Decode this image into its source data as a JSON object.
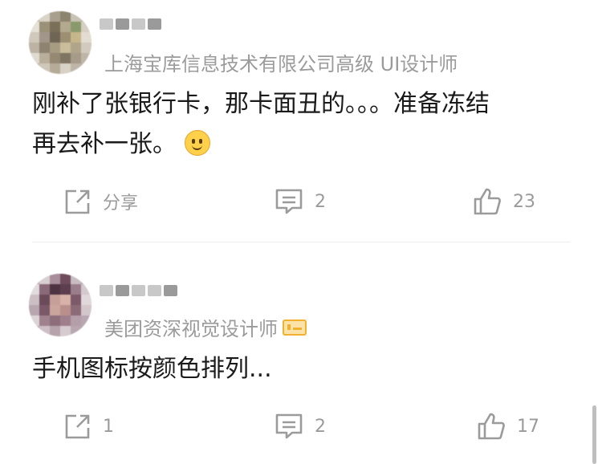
{
  "comments": [
    {
      "author_subtitle": "上海宝库信息技术有限公司高级 UI设计师",
      "verified_badge": false,
      "text_line1": "刚补了张银行卡，那卡面丑的。。。准备冻结",
      "text_line2": "再去补一张。",
      "emoji": "slightly-smiling-face",
      "share_label": "分享",
      "comment_count": "2",
      "like_count": "23"
    },
    {
      "author_subtitle": "美团资深视觉设计师",
      "verified_badge": true,
      "text_line1": "手机图标按颜色排列...",
      "share_label": "1",
      "comment_count": "2",
      "like_count": "17"
    }
  ],
  "icons": {
    "share": "share-icon",
    "comment": "comment-icon",
    "like": "thumbs-up-icon"
  },
  "colors": {
    "text": "#1a1a1a",
    "meta": "#9b9b9b",
    "badge": "#f0b030"
  }
}
